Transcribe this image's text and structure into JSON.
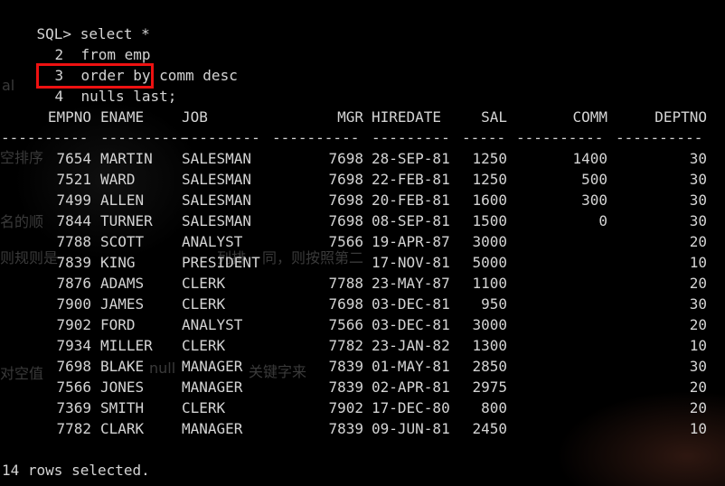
{
  "prompt": "SQL>",
  "query_lines": [
    {
      "num": "",
      "text": "select *"
    },
    {
      "num": "2",
      "text": "from emp"
    },
    {
      "num": "3",
      "text": "order by comm desc"
    },
    {
      "num": "4",
      "text": "nulls last;"
    }
  ],
  "highlight_color": "#ee1111",
  "ghost_texts": [
    "al",
    "空排序",
    "名的顺",
    "则规则是",
    "列排",
    "同，则按照第二",
    "对空值",
    "null",
    "关键字来"
  ],
  "columns": [
    "EMPNO",
    "ENAME",
    "JOB",
    "MGR",
    "HIREDATE",
    "SAL",
    "COMM",
    "DEPTNO"
  ],
  "separators": [
    "----------",
    "----------",
    "---------",
    "----------",
    "---------",
    "-----",
    "----------",
    "----------"
  ],
  "rows": [
    {
      "empno": "7654",
      "ename": "MARTIN",
      "job": "SALESMAN",
      "mgr": "7698",
      "hiredate": "28-SEP-81",
      "sal": "1250",
      "comm": "1400",
      "deptno": "30"
    },
    {
      "empno": "7521",
      "ename": "WARD",
      "job": "SALESMAN",
      "mgr": "7698",
      "hiredate": "22-FEB-81",
      "sal": "1250",
      "comm": "500",
      "deptno": "30"
    },
    {
      "empno": "7499",
      "ename": "ALLEN",
      "job": "SALESMAN",
      "mgr": "7698",
      "hiredate": "20-FEB-81",
      "sal": "1600",
      "comm": "300",
      "deptno": "30"
    },
    {
      "empno": "7844",
      "ename": "TURNER",
      "job": "SALESMAN",
      "mgr": "7698",
      "hiredate": "08-SEP-81",
      "sal": "1500",
      "comm": "0",
      "deptno": "30"
    },
    {
      "empno": "7788",
      "ename": "SCOTT",
      "job": "ANALYST",
      "mgr": "7566",
      "hiredate": "19-APR-87",
      "sal": "3000",
      "comm": "",
      "deptno": "20"
    },
    {
      "empno": "7839",
      "ename": "KING",
      "job": "PRESIDENT",
      "mgr": "",
      "hiredate": "17-NOV-81",
      "sal": "5000",
      "comm": "",
      "deptno": "10"
    },
    {
      "empno": "7876",
      "ename": "ADAMS",
      "job": "CLERK",
      "mgr": "7788",
      "hiredate": "23-MAY-87",
      "sal": "1100",
      "comm": "",
      "deptno": "20"
    },
    {
      "empno": "7900",
      "ename": "JAMES",
      "job": "CLERK",
      "mgr": "7698",
      "hiredate": "03-DEC-81",
      "sal": "950",
      "comm": "",
      "deptno": "30"
    },
    {
      "empno": "7902",
      "ename": "FORD",
      "job": "ANALYST",
      "mgr": "7566",
      "hiredate": "03-DEC-81",
      "sal": "3000",
      "comm": "",
      "deptno": "20"
    },
    {
      "empno": "7934",
      "ename": "MILLER",
      "job": "CLERK",
      "mgr": "7782",
      "hiredate": "23-JAN-82",
      "sal": "1300",
      "comm": "",
      "deptno": "10"
    },
    {
      "empno": "7698",
      "ename": "BLAKE",
      "job": "MANAGER",
      "mgr": "7839",
      "hiredate": "01-MAY-81",
      "sal": "2850",
      "comm": "",
      "deptno": "30"
    },
    {
      "empno": "7566",
      "ename": "JONES",
      "job": "MANAGER",
      "mgr": "7839",
      "hiredate": "02-APR-81",
      "sal": "2975",
      "comm": "",
      "deptno": "20"
    },
    {
      "empno": "7369",
      "ename": "SMITH",
      "job": "CLERK",
      "mgr": "7902",
      "hiredate": "17-DEC-80",
      "sal": "800",
      "comm": "",
      "deptno": "20"
    },
    {
      "empno": "7782",
      "ename": "CLARK",
      "job": "MANAGER",
      "mgr": "7839",
      "hiredate": "09-JUN-81",
      "sal": "2450",
      "comm": "",
      "deptno": "10"
    }
  ],
  "footer": "14 rows selected."
}
